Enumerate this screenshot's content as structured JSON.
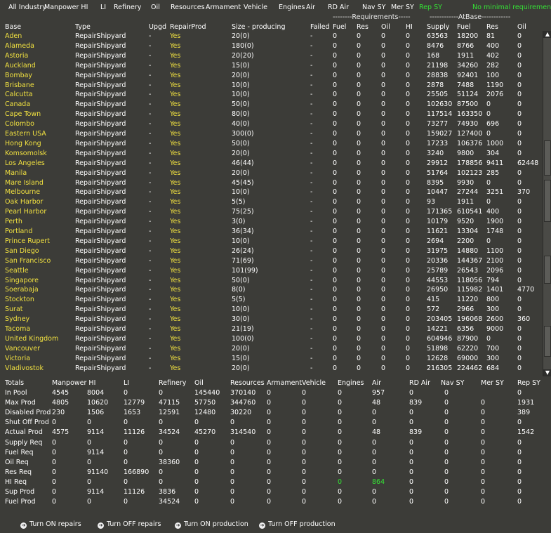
{
  "tabs": [
    {
      "label": "All Industry",
      "active": false
    },
    {
      "label": "Manpower HI",
      "active": false
    },
    {
      "label": "LI",
      "active": false
    },
    {
      "label": "Refinery",
      "active": false
    },
    {
      "label": "Oil",
      "active": false
    },
    {
      "label": "Resources",
      "active": false
    },
    {
      "label": "Armament",
      "active": false
    },
    {
      "label": "Vehicle",
      "active": false
    },
    {
      "label": "Engines",
      "active": false
    },
    {
      "label": "Air",
      "active": false
    },
    {
      "label": "RD Air",
      "active": false
    },
    {
      "label": "Nav SY",
      "active": false
    },
    {
      "label": "Mer SY",
      "active": false
    },
    {
      "label": "Rep SY",
      "active": true
    }
  ],
  "status_note": "No minimal requirement",
  "group_headers": {
    "requirements": "--------Requirements-----",
    "atbase": "------------AtBase------------"
  },
  "columns": [
    "Base",
    "Type",
    "Upgd",
    "RepairProd",
    "Size - producing",
    "Failed",
    "Fuel",
    "Res",
    "Oil",
    "HI",
    "Supply",
    "Fuel",
    "Res",
    "Oil"
  ],
  "rows": [
    [
      "Aden",
      "RepairShipyard",
      "-",
      "Yes",
      "-",
      "20(0)",
      "-",
      "0",
      "0",
      "0",
      "0",
      "63563",
      "18200",
      "81",
      "0"
    ],
    [
      "Alameda",
      "RepairShipyard",
      "-",
      "Yes",
      "-",
      "180(0)",
      "-",
      "0",
      "0",
      "0",
      "0",
      "8476",
      "8766",
      "400",
      "0"
    ],
    [
      "Astoria",
      "RepairShipyard",
      "-",
      "Yes",
      "-",
      "20(20)",
      "-",
      "0",
      "0",
      "0",
      "0",
      "168",
      "1911",
      "402",
      "0"
    ],
    [
      "Auckland",
      "RepairShipyard",
      "-",
      "Yes",
      "-",
      "15(0)",
      "-",
      "0",
      "0",
      "0",
      "0",
      "21198",
      "34260",
      "282",
      "0"
    ],
    [
      "Bombay",
      "RepairShipyard",
      "-",
      "Yes",
      "-",
      "20(0)",
      "-",
      "0",
      "0",
      "0",
      "0",
      "28838",
      "92401",
      "100",
      "0"
    ],
    [
      "Brisbane",
      "RepairShipyard",
      "-",
      "Yes",
      "-",
      "10(0)",
      "-",
      "0",
      "0",
      "0",
      "0",
      "2878",
      "7488",
      "1190",
      "0"
    ],
    [
      "Calcutta",
      "RepairShipyard",
      "-",
      "Yes",
      "-",
      "10(0)",
      "-",
      "0",
      "0",
      "0",
      "0",
      "25505",
      "51124",
      "2076",
      "0"
    ],
    [
      "Canada",
      "RepairShipyard",
      "-",
      "Yes",
      "-",
      "50(0)",
      "-",
      "0",
      "0",
      "0",
      "0",
      "102630",
      "87500",
      "0",
      "0"
    ],
    [
      "Cape Town",
      "RepairShipyard",
      "-",
      "Yes",
      "-",
      "80(0)",
      "-",
      "0",
      "0",
      "0",
      "0",
      "117514",
      "163350",
      "0",
      "0"
    ],
    [
      "Colombo",
      "RepairShipyard",
      "-",
      "Yes",
      "-",
      "40(0)",
      "-",
      "0",
      "0",
      "0",
      "0",
      "73277",
      "74930",
      "696",
      "0"
    ],
    [
      "Eastern USA",
      "RepairShipyard",
      "-",
      "Yes",
      "-",
      "300(0)",
      "-",
      "0",
      "0",
      "0",
      "0",
      "159027",
      "127400",
      "0",
      "0"
    ],
    [
      "Hong Kong",
      "RepairShipyard",
      "-",
      "Yes",
      "-",
      "50(0)",
      "-",
      "0",
      "0",
      "0",
      "0",
      "17233",
      "106376",
      "1000",
      "0"
    ],
    [
      "Komsomolsk",
      "RepairShipyard",
      "-",
      "Yes",
      "-",
      "20(0)",
      "-",
      "0",
      "0",
      "0",
      "0",
      "3240",
      "9800",
      "304",
      "0"
    ],
    [
      "Los Angeles",
      "RepairShipyard",
      "-",
      "Yes",
      "-",
      "46(44)",
      "-",
      "0",
      "0",
      "0",
      "0",
      "29912",
      "178856",
      "9411",
      "62448"
    ],
    [
      "Manila",
      "RepairShipyard",
      "-",
      "Yes",
      "-",
      "20(0)",
      "-",
      "0",
      "0",
      "0",
      "0",
      "51764",
      "102123",
      "285",
      "0"
    ],
    [
      "Mare Island",
      "RepairShipyard",
      "-",
      "Yes",
      "-",
      "45(45)",
      "-",
      "0",
      "0",
      "0",
      "0",
      "8395",
      "9930",
      "0",
      "0"
    ],
    [
      "Melbourne",
      "RepairShipyard",
      "-",
      "Yes",
      "-",
      "10(0)",
      "-",
      "0",
      "0",
      "0",
      "0",
      "10447",
      "27244",
      "3251",
      "370"
    ],
    [
      "Oak Harbor",
      "RepairShipyard",
      "-",
      "Yes",
      "-",
      "5(5)",
      "-",
      "0",
      "0",
      "0",
      "0",
      "93",
      "1911",
      "0",
      "0"
    ],
    [
      "Pearl Harbor",
      "RepairShipyard",
      "-",
      "Yes",
      "-",
      "75(25)",
      "-",
      "0",
      "0",
      "0",
      "0",
      "171365",
      "610541",
      "400",
      "0"
    ],
    [
      "Perth",
      "RepairShipyard",
      "-",
      "Yes",
      "-",
      "3(0)",
      "-",
      "0",
      "0",
      "0",
      "0",
      "10179",
      "9520",
      "1900",
      "0"
    ],
    [
      "Portland",
      "RepairShipyard",
      "-",
      "Yes",
      "-",
      "36(34)",
      "-",
      "0",
      "0",
      "0",
      "0",
      "11621",
      "13304",
      "1748",
      "0"
    ],
    [
      "Prince Rupert",
      "RepairShipyard",
      "-",
      "Yes",
      "-",
      "10(0)",
      "-",
      "0",
      "0",
      "0",
      "0",
      "2694",
      "2200",
      "0",
      "0"
    ],
    [
      "San Diego",
      "RepairShipyard",
      "-",
      "Yes",
      "-",
      "26(24)",
      "-",
      "0",
      "0",
      "0",
      "0",
      "31975",
      "14880",
      "1100",
      "0"
    ],
    [
      "San Francisco",
      "RepairShipyard",
      "-",
      "Yes",
      "-",
      "71(69)",
      "-",
      "0",
      "0",
      "0",
      "0",
      "20336",
      "144367",
      "2100",
      "0"
    ],
    [
      "Seattle",
      "RepairShipyard",
      "-",
      "Yes",
      "-",
      "101(99)",
      "-",
      "0",
      "0",
      "0",
      "0",
      "25789",
      "26543",
      "2096",
      "0"
    ],
    [
      "Singapore",
      "RepairShipyard",
      "-",
      "Yes",
      "-",
      "50(0)",
      "-",
      "0",
      "0",
      "0",
      "0",
      "44553",
      "118056",
      "794",
      "0"
    ],
    [
      "Soerabaja",
      "RepairShipyard",
      "-",
      "Yes",
      "-",
      "8(0)",
      "-",
      "0",
      "0",
      "0",
      "0",
      "26950",
      "115982",
      "1401",
      "4770"
    ],
    [
      "Stockton",
      "RepairShipyard",
      "-",
      "Yes",
      "-",
      "5(5)",
      "-",
      "0",
      "0",
      "0",
      "0",
      "415",
      "11220",
      "800",
      "0"
    ],
    [
      "Surat",
      "RepairShipyard",
      "-",
      "Yes",
      "-",
      "10(0)",
      "-",
      "0",
      "0",
      "0",
      "0",
      "572",
      "2966",
      "300",
      "0"
    ],
    [
      "Sydney",
      "RepairShipyard",
      "-",
      "Yes",
      "-",
      "30(0)",
      "-",
      "0",
      "0",
      "0",
      "0",
      "203405",
      "196068",
      "2600",
      "360"
    ],
    [
      "Tacoma",
      "RepairShipyard",
      "-",
      "Yes",
      "-",
      "21(19)",
      "-",
      "0",
      "0",
      "0",
      "0",
      "14221",
      "6356",
      "9000",
      "0"
    ],
    [
      "United Kingdom",
      "RepairShipyard",
      "-",
      "Yes",
      "-",
      "100(0)",
      "-",
      "0",
      "0",
      "0",
      "0",
      "604946",
      "87900",
      "0",
      "0"
    ],
    [
      "Vancouver",
      "RepairShipyard",
      "-",
      "Yes",
      "-",
      "20(0)",
      "-",
      "0",
      "0",
      "0",
      "0",
      "51898",
      "62220",
      "700",
      "0"
    ],
    [
      "Victoria",
      "RepairShipyard",
      "-",
      "Yes",
      "-",
      "15(0)",
      "-",
      "0",
      "0",
      "0",
      "0",
      "12628",
      "69000",
      "300",
      "0"
    ],
    [
      "Vladivostok",
      "RepairShipyard",
      "-",
      "Yes",
      "-",
      "20(0)",
      "-",
      "0",
      "0",
      "0",
      "0",
      "216305",
      "224462",
      "684",
      "0"
    ]
  ],
  "totals_headers": [
    "Totals",
    "Manpower HI",
    "LI",
    "Refinery",
    "Oil",
    "Resources",
    "Armament",
    "Vehicle",
    "Engines",
    "Air",
    "RD Air",
    "Nav SY",
    "Mer SY",
    "Rep SY"
  ],
  "totals_rows": [
    [
      "In Pool",
      "4545",
      "8004",
      "0",
      "0",
      "145440",
      "370140",
      "0",
      "0",
      "0",
      "957",
      "0",
      "0",
      "0"
    ],
    [
      "Max Prod",
      "4805",
      "10620",
      "12779",
      "47115",
      "57750",
      "344760",
      "0",
      "0",
      "0",
      "48",
      "839",
      "0",
      "0",
      "1931"
    ],
    [
      "Disabled Prod",
      "230",
      "1506",
      "1653",
      "12591",
      "12480",
      "30220",
      "0",
      "0",
      "0",
      "0",
      "0",
      "0",
      "0",
      "389"
    ],
    [
      "Shut Off Prod",
      "0",
      "0",
      "0",
      "0",
      "0",
      "0",
      "0",
      "0",
      "0",
      "0",
      "0",
      "0",
      "0",
      "0"
    ],
    [
      "Actual Prod",
      "4575",
      "9114",
      "11126",
      "34524",
      "45270",
      "314540",
      "0",
      "0",
      "0",
      "48",
      "839",
      "0",
      "0",
      "1542"
    ],
    [
      "Supply Req",
      "0",
      "0",
      "0",
      "0",
      "0",
      "0",
      "0",
      "0",
      "0",
      "0",
      "0",
      "0",
      "0",
      "0"
    ],
    [
      "Fuel Req",
      "0",
      "9114",
      "0",
      "0",
      "0",
      "0",
      "0",
      "0",
      "0",
      "0",
      "0",
      "0",
      "0",
      "0"
    ],
    [
      "Oil Req",
      "0",
      "0",
      "0",
      "38360",
      "0",
      "0",
      "0",
      "0",
      "0",
      "0",
      "0",
      "0",
      "0",
      "0"
    ],
    [
      "Res Req",
      "0",
      "91140",
      "166890",
      "0",
      "0",
      "0",
      "0",
      "0",
      "0",
      "0",
      "0",
      "0",
      "0",
      "0"
    ],
    [
      "HI Req",
      "0",
      "0",
      "0",
      "0",
      "0",
      "0",
      "0",
      "0",
      "0",
      "864",
      "0",
      "0",
      "0",
      "0"
    ],
    [
      "Sup Prod",
      "0",
      "9114",
      "11126",
      "3836",
      "0",
      "0",
      "0",
      "0",
      "0",
      "0",
      "0",
      "0",
      "0",
      "0"
    ],
    [
      "Fuel Prod",
      "0",
      "0",
      "0",
      "34524",
      "0",
      "0",
      "0",
      "0",
      "0",
      "0",
      "0",
      "0",
      "0",
      "0"
    ]
  ],
  "buttons": [
    {
      "label": "Turn ON repairs",
      "icon": "arrow-right-icon"
    },
    {
      "label": "Turn OFF repairs",
      "icon": "arrow-right-icon"
    },
    {
      "label": "Turn ON production",
      "icon": "arrow-right-icon"
    },
    {
      "label": "Turn OFF production",
      "icon": "arrow-right-icon"
    }
  ],
  "colors": {
    "background": "#3c3c38",
    "yellow": "#f0e040",
    "green": "#35e035",
    "white": "#ffffff"
  }
}
